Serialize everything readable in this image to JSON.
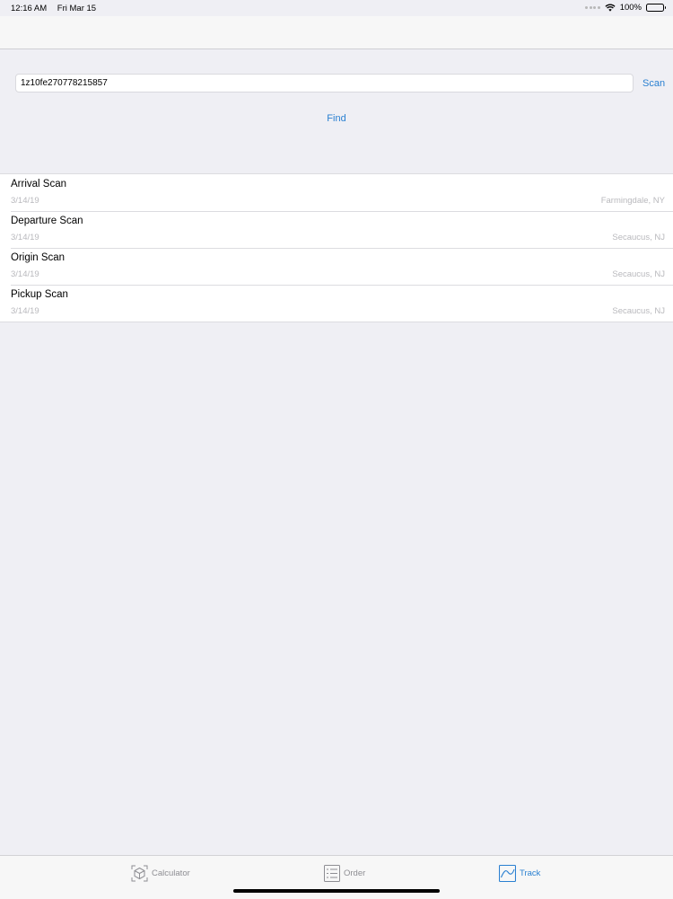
{
  "status_bar": {
    "time": "12:16 AM",
    "date": "Fri Mar 15",
    "battery": "100%",
    "icons": [
      "signal-dots-icon",
      "wifi-icon",
      "battery-icon"
    ]
  },
  "search": {
    "tracking_number": "1z10fe270778215857",
    "scan_label": "Scan",
    "find_label": "Find"
  },
  "tracking_events": [
    {
      "title": "Arrival Scan",
      "date": "3/14/19",
      "location": "Farmingdale, NY"
    },
    {
      "title": "Departure Scan",
      "date": "3/14/19",
      "location": "Secaucus, NJ"
    },
    {
      "title": "Origin Scan",
      "date": "3/14/19",
      "location": "Secaucus, NJ"
    },
    {
      "title": "Pickup Scan",
      "date": "3/14/19",
      "location": "Secaucus, NJ"
    }
  ],
  "tab_bar": {
    "tabs": [
      {
        "label": "Calculator",
        "icon": "calculator-icon",
        "active": false
      },
      {
        "label": "Order",
        "icon": "list-icon",
        "active": false
      },
      {
        "label": "Track",
        "icon": "chart-line-icon",
        "active": true
      }
    ]
  },
  "colors": {
    "accent": "#2a80d1",
    "background": "#efeff4",
    "secondary_text": "#b9b9bd"
  }
}
